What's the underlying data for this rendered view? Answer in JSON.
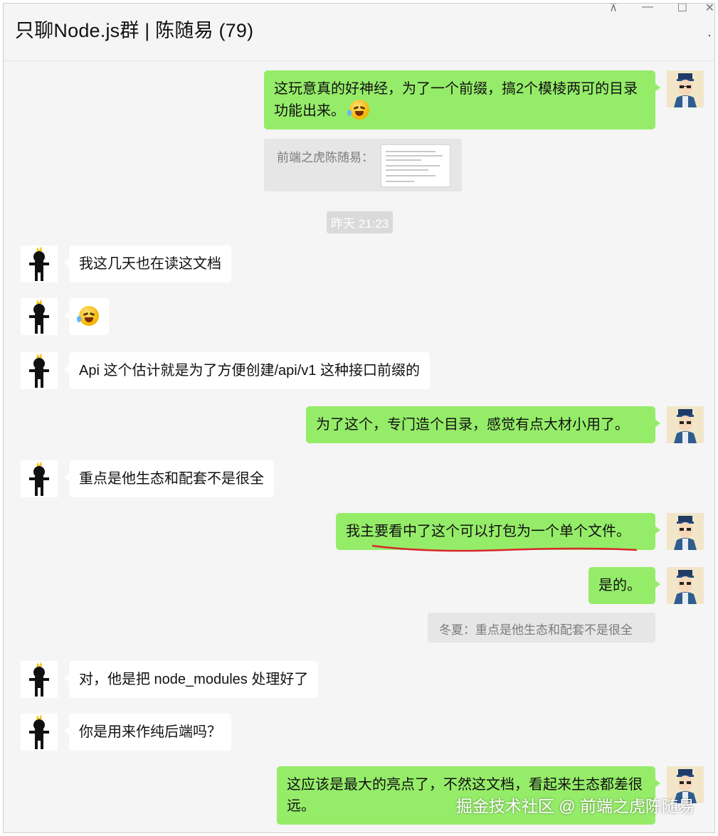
{
  "window": {
    "title": "只聊Node.js群 | 陈随易 (79)",
    "controls": {
      "pin": "⊼",
      "minimize": "—",
      "maximize": "☐",
      "close": "✕",
      "more": "·"
    }
  },
  "messages": [
    {
      "id": "m1",
      "sender": "self",
      "text": "这玩意真的好神经，为了一个前缀，搞2个模棱两可的目录功能出来。",
      "emoji": "laugh-cry"
    },
    {
      "id": "q1",
      "type": "quote",
      "text": "前端之虎陈随易："
    },
    {
      "id": "t1",
      "type": "time",
      "text": "昨天 21:23"
    },
    {
      "id": "m2",
      "sender": "other",
      "text": "我这几天也在读这文档"
    },
    {
      "id": "m3",
      "sender": "other",
      "text": "",
      "emoji": "laugh-cry"
    },
    {
      "id": "m4",
      "sender": "other",
      "text": "Api 这个估计就是为了方便创建/api/v1 这种接口前缀的"
    },
    {
      "id": "m5",
      "sender": "self",
      "text": "为了这个，专门造个目录，感觉有点大材小用了。"
    },
    {
      "id": "m6",
      "sender": "other",
      "text": "重点是他生态和配套不是很全"
    },
    {
      "id": "m7",
      "sender": "self",
      "text": "我主要看中了这个可以打包为一个单个文件。",
      "annotation": "red-underline"
    },
    {
      "id": "m8",
      "sender": "self",
      "text": "是的。"
    },
    {
      "id": "q2",
      "type": "quote",
      "text": "冬夏：重点是他生态和配套不是很全"
    },
    {
      "id": "m9",
      "sender": "other",
      "text": "对，他是把 node_modules 处理好了"
    },
    {
      "id": "m10",
      "sender": "other",
      "text": "你是用来作纯后端吗？"
    },
    {
      "id": "m11",
      "sender": "self",
      "text": "这应该是最大的亮点了，不然这文档，看起来生态都差很远。"
    }
  ],
  "watermark": "掘金技术社区 @ 前端之虎陈随易",
  "colors": {
    "self_bubble": "#95ec69",
    "other_bubble": "#ffffff",
    "background": "#f5f5f5",
    "annotation": "#d9262c"
  }
}
